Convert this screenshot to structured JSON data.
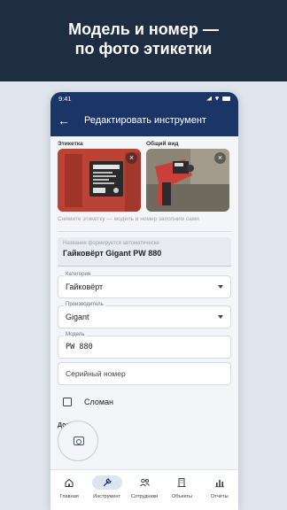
{
  "banner": {
    "title_line1": "Модель и номер —",
    "title_line2": "по фото этикетки"
  },
  "status": {
    "time": "9:41"
  },
  "appbar": {
    "title": "Редактировать инструмент"
  },
  "photos": {
    "label_tag": "Этикетка",
    "label_view": "Общий вид",
    "remove_symbol": "×"
  },
  "hint": "Снимите этикетку — модель и номер заполним сами",
  "autofill": {
    "label": "Название формируется автоматически",
    "value": "Гайковёрт Gigant PW 880"
  },
  "fields": {
    "category": {
      "label": "Категория",
      "value": "Гайковёрт"
    },
    "manufacturer": {
      "label": "Производитель",
      "value": "Gigant"
    },
    "model": {
      "label": "Модель",
      "value": "PW 880"
    },
    "serial": {
      "placeholder": "Серийный номер"
    }
  },
  "broken": {
    "label": "Сломан",
    "checked": false
  },
  "extra_photos": {
    "label": "Доп. фото"
  },
  "nav": [
    {
      "label": "Главная",
      "icon": "home-icon",
      "active": false
    },
    {
      "label": "Инструмент",
      "icon": "wrench-icon",
      "active": true
    },
    {
      "label": "Сотрудники",
      "icon": "people-icon",
      "active": false
    },
    {
      "label": "Объекты",
      "icon": "building-icon",
      "active": false
    },
    {
      "label": "Отчёты",
      "icon": "bar-chart-icon",
      "active": false
    }
  ],
  "colors": {
    "banner": "#1f2d42",
    "appbar": "#1b3566",
    "accent": "#1b3566",
    "page_bg": "#dfe5ec"
  }
}
